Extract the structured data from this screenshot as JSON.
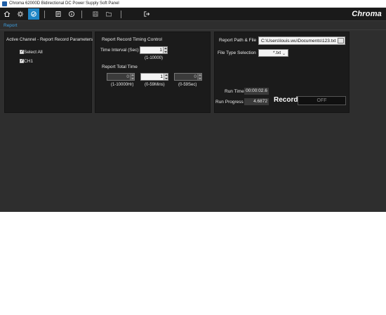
{
  "window": {
    "title": "Chroma 62000D Bidirectional DC Power Supply Soft Panel"
  },
  "toolbar": {
    "buttons": [
      {
        "icon": "home-icon",
        "active": false
      },
      {
        "icon": "settings-icon",
        "active": false
      },
      {
        "icon": "report-icon",
        "active": true
      },
      {
        "icon": "list-icon",
        "active": false
      },
      {
        "icon": "info-icon",
        "active": false
      },
      {
        "icon": "save-icon",
        "active": false
      },
      {
        "icon": "open-folder-icon",
        "active": false
      },
      {
        "icon": "exit-icon",
        "active": false
      }
    ],
    "brand": "Chroma"
  },
  "breadcrumb": "Report",
  "channel_panel": {
    "title": "Active Channel - Report Record Parameters",
    "select_all": {
      "label": "Select All",
      "checked": true
    },
    "channels": [
      {
        "label": "CH1",
        "checked": true
      }
    ]
  },
  "timing_panel": {
    "title": "Report Record Timing Control",
    "interval": {
      "label": "Time Interval (Sec)",
      "value": "1",
      "range": "(1-10000)"
    },
    "total_time": {
      "label": "Report Total Time",
      "hours": {
        "value": "0",
        "range": "(1-10000Hr)"
      },
      "minutes": {
        "value": "1",
        "range": "(0-59Mins)"
      },
      "seconds": {
        "value": "0",
        "range": "(0-59Sec)"
      }
    }
  },
  "record_panel": {
    "path_label": "Report Path & File",
    "path_value": "C:\\Users\\louis.wu\\Documents\\123.txt",
    "file_type_label": "File Type Selection",
    "file_type_value": "*.txt",
    "run_time_label": "Run Time",
    "run_time_value": "00:00:02.6",
    "run_progress_label": "Run Progress",
    "run_progress_value": "4.6872",
    "record_label": "Record",
    "record_toggle": "OFF"
  },
  "colors": {
    "accent": "#1f86c6",
    "background": "#2e2e2e",
    "panel": "#1b1b1b",
    "link": "#3d9fe0"
  }
}
